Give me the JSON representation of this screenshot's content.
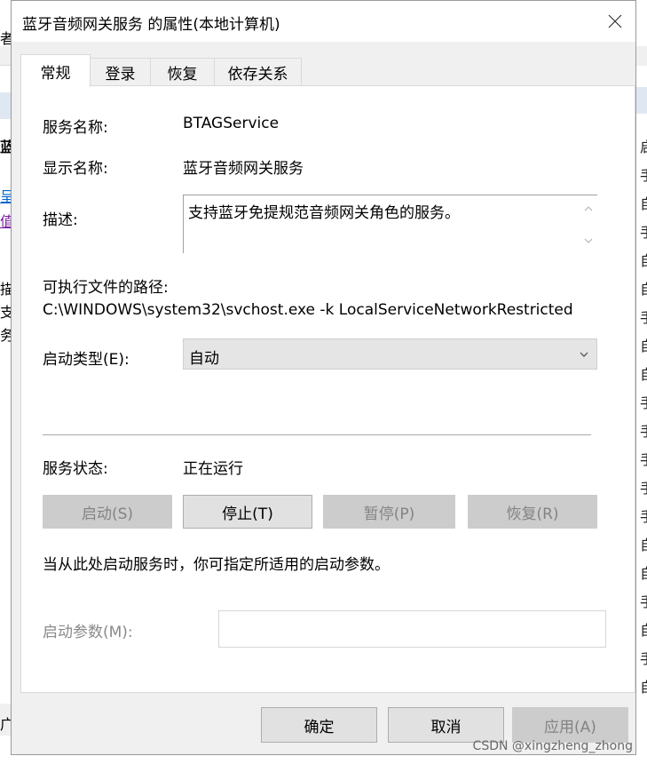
{
  "window": {
    "title": "蓝牙音频网关服务 的属性(本地计算机)"
  },
  "tabs": [
    {
      "label": "常规",
      "active": true
    },
    {
      "label": "登录",
      "active": false
    },
    {
      "label": "恢复",
      "active": false
    },
    {
      "label": "依存关系",
      "active": false
    }
  ],
  "general": {
    "service_name_label": "服务名称:",
    "service_name_value": "BTAGService",
    "display_name_label": "显示名称:",
    "display_name_value": "蓝牙音频网关服务",
    "description_label": "描述:",
    "description_value": "支持蓝牙免提规范音频网关角色的服务。",
    "path_label": "可执行文件的路径:",
    "path_value": "C:\\WINDOWS\\system32\\svchost.exe -k LocalServiceNetworkRestricted",
    "startup_type_label": "启动类型(E):",
    "startup_type_value": "自动",
    "status_label": "服务状态:",
    "status_value": "正在运行",
    "buttons": {
      "start": "启动(S)",
      "stop": "停止(T)",
      "pause": "暂停(P)",
      "resume": "恢复(R)"
    },
    "hint": "当从此处启动服务时，你可指定所适用的启动参数。",
    "params_label": "启动参数(M):",
    "params_value": ""
  },
  "footer": {
    "ok": "确定",
    "cancel": "取消",
    "apply": "应用(A)"
  },
  "watermark": "CSDN @xingzheng_zhong",
  "background": {
    "left_fragments": [
      "者(",
      "蓝牙",
      "呈",
      "值",
      "描述",
      "支持",
      "务。",
      "广"
    ],
    "right_fragments": [
      "启",
      "手",
      "自",
      "手",
      "自",
      "自",
      "手",
      "自",
      "自",
      "手",
      "手",
      "手",
      "手",
      "手",
      "自",
      "自",
      "手",
      "自",
      "手",
      "自"
    ]
  },
  "colors": {
    "dialog_bg": "#f0f0f0",
    "pane_bg": "#ffffff",
    "button_enabled": "#e1e1e1",
    "button_disabled": "#cccccc",
    "disabled_text": "#838383"
  }
}
